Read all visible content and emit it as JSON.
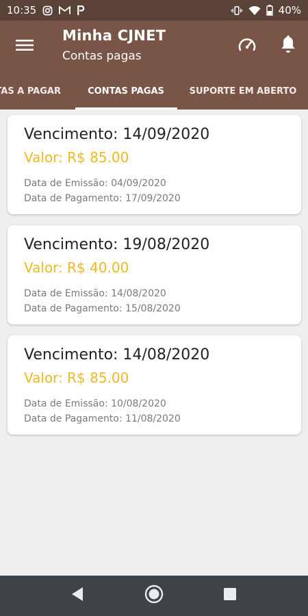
{
  "status_bar": {
    "time": "10:35",
    "battery": "40%",
    "icons_left": [
      "instagram-icon",
      "gmail-icon",
      "paypal-icon"
    ],
    "icons_right": [
      "vibrate-icon",
      "wifi-icon",
      "battery-icon"
    ]
  },
  "app_bar": {
    "title": "Minha CJNET",
    "subtitle": "Contas pagas",
    "background": "#795548"
  },
  "tabs": [
    {
      "label": "TAS A PAGAR"
    },
    {
      "label": "CONTAS PAGAS",
      "selected": true
    },
    {
      "label": "SUPORTE EM ABERTO"
    }
  ],
  "bills": [
    {
      "due": "Vencimento: 14/09/2020",
      "value": "Valor: R$ 85.00",
      "issue": "Data de Emissão: 04/09/2020",
      "paid": "Data de Pagamento: 17/09/2020"
    },
    {
      "due": "Vencimento: 19/08/2020",
      "value": "Valor: R$ 40.00",
      "issue": "Data de Emissão: 14/08/2020",
      "paid": "Data de Pagamento: 15/08/2020"
    },
    {
      "due": "Vencimento: 14/08/2020",
      "value": "Valor: R$ 85.00",
      "issue": "Data de Emissão: 10/08/2020",
      "paid": "Data de Pagamento: 11/08/2020"
    }
  ],
  "colors": {
    "status_bar": "#5b4238",
    "accent_value": "#f2b821",
    "nav_bar": "#3e4447"
  },
  "nav_bar": {
    "icons": [
      "back-icon",
      "home-icon",
      "recents-icon"
    ]
  }
}
